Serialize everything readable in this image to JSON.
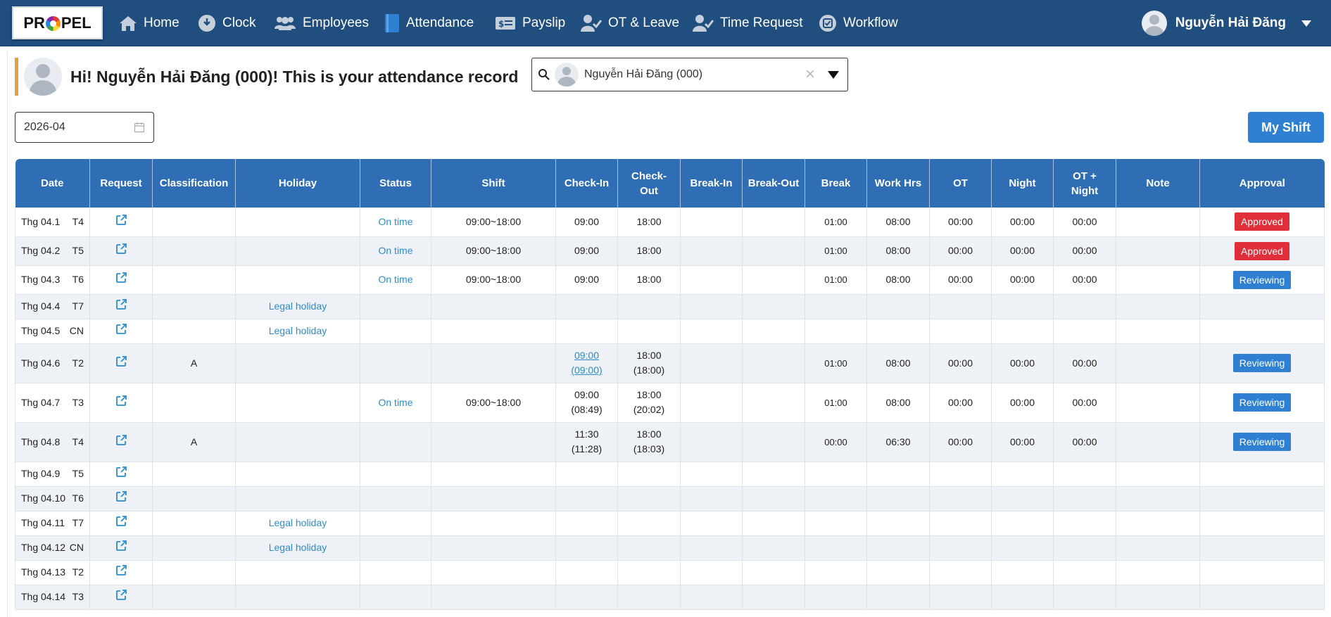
{
  "logo": {
    "left": "PR",
    "right": "PEL"
  },
  "nav": {
    "items": [
      {
        "label": "Home",
        "icon": "home-icon"
      },
      {
        "label": "Clock",
        "icon": "clock-icon"
      },
      {
        "label": "Employees",
        "icon": "employees-icon"
      },
      {
        "label": "Attendance",
        "icon": "attendance-icon"
      },
      {
        "label": "Payslip",
        "icon": "payslip-icon"
      },
      {
        "label": "OT & Leave",
        "icon": "ot-leave-icon"
      },
      {
        "label": "Time Request",
        "icon": "time-request-icon"
      },
      {
        "label": "Workflow",
        "icon": "workflow-icon"
      }
    ],
    "user_name": "Nguyễn Hải Đăng"
  },
  "greeting": "Hi! Nguyễn Hải Đăng (000)! This is your attendance record",
  "employee_select": {
    "value": "Nguyễn Hải Đăng (000)",
    "clear": "×"
  },
  "month": "2026-04",
  "my_shift_label": "My Shift",
  "colors": {
    "nav_bg": "#1f4e7f",
    "header_bg": "#2f6db5",
    "approved": "#e02f3a",
    "reviewing": "#2f80d3",
    "link": "#2e8ccb",
    "accent_bar": "#e2a33c"
  },
  "table": {
    "headers": [
      "Date",
      "Request",
      "Classification",
      "Holiday",
      "Status",
      "Shift",
      "Check-In",
      "Check-Out",
      "Break-In",
      "Break-Out",
      "Break",
      "Work Hrs",
      "OT",
      "Night",
      "OT + Night",
      "Note",
      "Approval"
    ],
    "rows": [
      {
        "date": "Thg 04.1",
        "dow": "T4",
        "classification": "",
        "holiday": "",
        "status": "On time",
        "shift": "09:00~18:00",
        "check_in": "09:00",
        "check_in_actual": "",
        "check_out": "18:00",
        "check_out_actual": "",
        "break_in": "",
        "break_out": "",
        "break": "01:00",
        "work_hrs": "08:00",
        "ot": "00:00",
        "night": "00:00",
        "ot_night": "00:00",
        "note": "",
        "approval": "Approved"
      },
      {
        "date": "Thg 04.2",
        "dow": "T5",
        "classification": "",
        "holiday": "",
        "status": "On time",
        "shift": "09:00~18:00",
        "check_in": "09:00",
        "check_in_actual": "",
        "check_out": "18:00",
        "check_out_actual": "",
        "break_in": "",
        "break_out": "",
        "break": "01:00",
        "work_hrs": "08:00",
        "ot": "00:00",
        "night": "00:00",
        "ot_night": "00:00",
        "note": "",
        "approval": "Approved"
      },
      {
        "date": "Thg 04.3",
        "dow": "T6",
        "classification": "",
        "holiday": "",
        "status": "On time",
        "shift": "09:00~18:00",
        "check_in": "09:00",
        "check_in_actual": "",
        "check_out": "18:00",
        "check_out_actual": "",
        "break_in": "",
        "break_out": "",
        "break": "01:00",
        "work_hrs": "08:00",
        "ot": "00:00",
        "night": "00:00",
        "ot_night": "00:00",
        "note": "",
        "approval": "Reviewing"
      },
      {
        "date": "Thg 04.4",
        "dow": "T7",
        "classification": "",
        "holiday": "Legal holiday",
        "status": "",
        "shift": "",
        "check_in": "",
        "check_in_actual": "",
        "check_out": "",
        "check_out_actual": "",
        "break_in": "",
        "break_out": "",
        "break": "",
        "work_hrs": "",
        "ot": "",
        "night": "",
        "ot_night": "",
        "note": "",
        "approval": ""
      },
      {
        "date": "Thg 04.5",
        "dow": "CN",
        "classification": "",
        "holiday": "Legal holiday",
        "status": "",
        "shift": "",
        "check_in": "",
        "check_in_actual": "",
        "check_out": "",
        "check_out_actual": "",
        "break_in": "",
        "break_out": "",
        "break": "",
        "work_hrs": "",
        "ot": "",
        "night": "",
        "ot_night": "",
        "note": "",
        "approval": ""
      },
      {
        "date": "Thg 04.6",
        "dow": "T2",
        "classification": "A",
        "holiday": "",
        "status": "",
        "shift": "",
        "check_in": "09:00",
        "check_in_actual": "(09:00)",
        "check_in_link": true,
        "check_out": "18:00",
        "check_out_actual": "(18:00)",
        "break_in": "",
        "break_out": "",
        "break": "01:00",
        "work_hrs": "08:00",
        "ot": "00:00",
        "night": "00:00",
        "ot_night": "00:00",
        "note": "",
        "approval": "Reviewing"
      },
      {
        "date": "Thg 04.7",
        "dow": "T3",
        "classification": "",
        "holiday": "",
        "status": "On time",
        "shift": "09:00~18:00",
        "check_in": "09:00",
        "check_in_actual": "(08:49)",
        "check_out": "18:00",
        "check_out_actual": "(20:02)",
        "break_in": "",
        "break_out": "",
        "break": "01:00",
        "work_hrs": "08:00",
        "ot": "00:00",
        "night": "00:00",
        "ot_night": "00:00",
        "note": "",
        "approval": "Reviewing"
      },
      {
        "date": "Thg 04.8",
        "dow": "T4",
        "classification": "A",
        "holiday": "",
        "status": "",
        "shift": "",
        "check_in": "11:30",
        "check_in_actual": "(11:28)",
        "check_out": "18:00",
        "check_out_actual": "(18:03)",
        "break_in": "",
        "break_out": "",
        "break": "00:00",
        "work_hrs": "06:30",
        "ot": "00:00",
        "night": "00:00",
        "ot_night": "00:00",
        "note": "",
        "approval": "Reviewing"
      },
      {
        "date": "Thg 04.9",
        "dow": "T5",
        "classification": "",
        "holiday": "",
        "status": "",
        "shift": "",
        "check_in": "",
        "check_in_actual": "",
        "check_out": "",
        "check_out_actual": "",
        "break_in": "",
        "break_out": "",
        "break": "",
        "work_hrs": "",
        "ot": "",
        "night": "",
        "ot_night": "",
        "note": "",
        "approval": ""
      },
      {
        "date": "Thg 04.10",
        "dow": "T6",
        "classification": "",
        "holiday": "",
        "status": "",
        "shift": "",
        "check_in": "",
        "check_in_actual": "",
        "check_out": "",
        "check_out_actual": "",
        "break_in": "",
        "break_out": "",
        "break": "",
        "work_hrs": "",
        "ot": "",
        "night": "",
        "ot_night": "",
        "note": "",
        "approval": ""
      },
      {
        "date": "Thg 04.11",
        "dow": "T7",
        "classification": "",
        "holiday": "Legal holiday",
        "status": "",
        "shift": "",
        "check_in": "",
        "check_in_actual": "",
        "check_out": "",
        "check_out_actual": "",
        "break_in": "",
        "break_out": "",
        "break": "",
        "work_hrs": "",
        "ot": "",
        "night": "",
        "ot_night": "",
        "note": "",
        "approval": ""
      },
      {
        "date": "Thg 04.12",
        "dow": "CN",
        "classification": "",
        "holiday": "Legal holiday",
        "status": "",
        "shift": "",
        "check_in": "",
        "check_in_actual": "",
        "check_out": "",
        "check_out_actual": "",
        "break_in": "",
        "break_out": "",
        "break": "",
        "work_hrs": "",
        "ot": "",
        "night": "",
        "ot_night": "",
        "note": "",
        "approval": ""
      },
      {
        "date": "Thg 04.13",
        "dow": "T2",
        "classification": "",
        "holiday": "",
        "status": "",
        "shift": "",
        "check_in": "",
        "check_in_actual": "",
        "check_out": "",
        "check_out_actual": "",
        "break_in": "",
        "break_out": "",
        "break": "",
        "work_hrs": "",
        "ot": "",
        "night": "",
        "ot_night": "",
        "note": "",
        "approval": ""
      },
      {
        "date": "Thg 04.14",
        "dow": "T3",
        "classification": "",
        "holiday": "",
        "status": "",
        "shift": "",
        "check_in": "",
        "check_in_actual": "",
        "check_out": "",
        "check_out_actual": "",
        "break_in": "",
        "break_out": "",
        "break": "",
        "work_hrs": "",
        "ot": "",
        "night": "",
        "ot_night": "",
        "note": "",
        "approval": ""
      }
    ]
  }
}
